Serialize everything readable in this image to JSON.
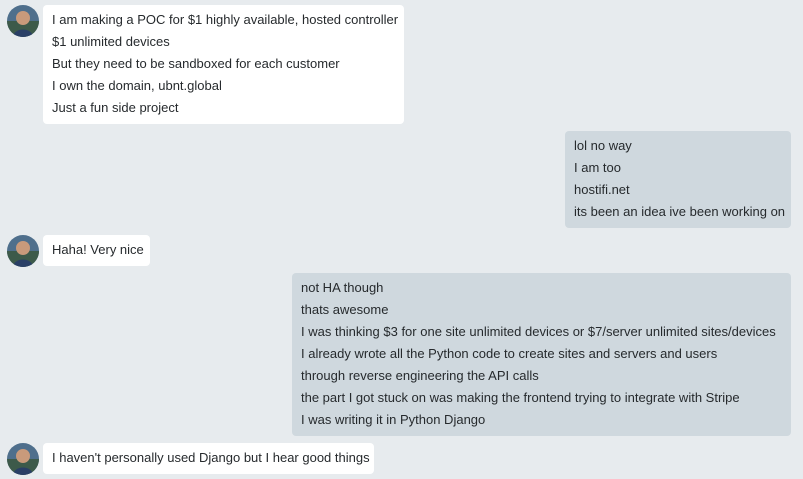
{
  "conversation": {
    "messages": [
      {
        "sender": "contact",
        "lines": [
          "I am making a POC for $1 highly available, hosted controller",
          "$1 unlimited devices",
          "But they need to be sandboxed for each customer",
          "I own the domain, ubnt.global",
          "Just a fun side project"
        ]
      },
      {
        "sender": "me",
        "lines": [
          "lol no way",
          "I am too",
          "hostifi.net",
          "its been an idea ive been working on"
        ]
      },
      {
        "sender": "contact",
        "lines": [
          "Haha! Very nice"
        ]
      },
      {
        "sender": "me",
        "lines": [
          "not HA though",
          "thats awesome",
          "I was thinking $3 for one site unlimited devices or $7/server unlimited sites/devices",
          "I already wrote all the Python code to create sites and servers and users",
          "through reverse engineering the API calls",
          "the part I got stuck on was making the frontend trying to integrate with Stripe",
          "I was writing it in Python Django"
        ]
      },
      {
        "sender": "contact",
        "lines": [
          "I haven't personally used Django but I hear good things"
        ]
      }
    ]
  },
  "colors": {
    "background": "#e7ebee",
    "incoming_bubble": "#ffffff",
    "outgoing_bubble": "#cfd8de",
    "text": "#262a2d"
  },
  "icons": {
    "contact_avatar": "avatar-icon"
  }
}
